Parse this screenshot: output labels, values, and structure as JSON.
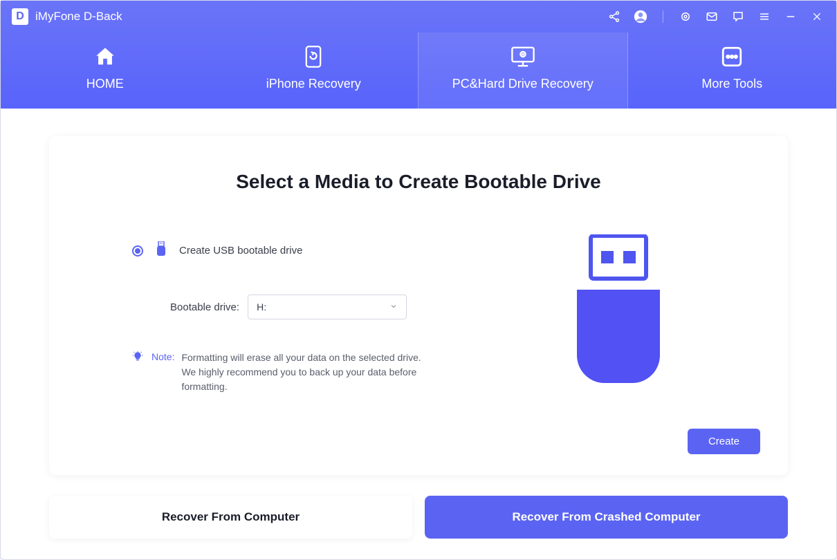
{
  "app": {
    "title": "iMyFone D-Back",
    "logo_letter": "D"
  },
  "nav": {
    "home": "HOME",
    "iphone": "iPhone Recovery",
    "pc": "PC&Hard Drive Recovery",
    "more": "More Tools"
  },
  "main": {
    "heading": "Select a Media to Create Bootable Drive",
    "option_usb_label": "Create USB bootable drive",
    "drive_label": "Bootable drive:",
    "drive_selected": "H:",
    "note_label": "Note:",
    "note_text": "Formatting will erase all your data on the selected drive. We highly recommend you to back up your data before formatting.",
    "create_button": "Create"
  },
  "bottom": {
    "recover_computer": "Recover From Computer",
    "recover_crashed": "Recover From Crashed Computer"
  }
}
